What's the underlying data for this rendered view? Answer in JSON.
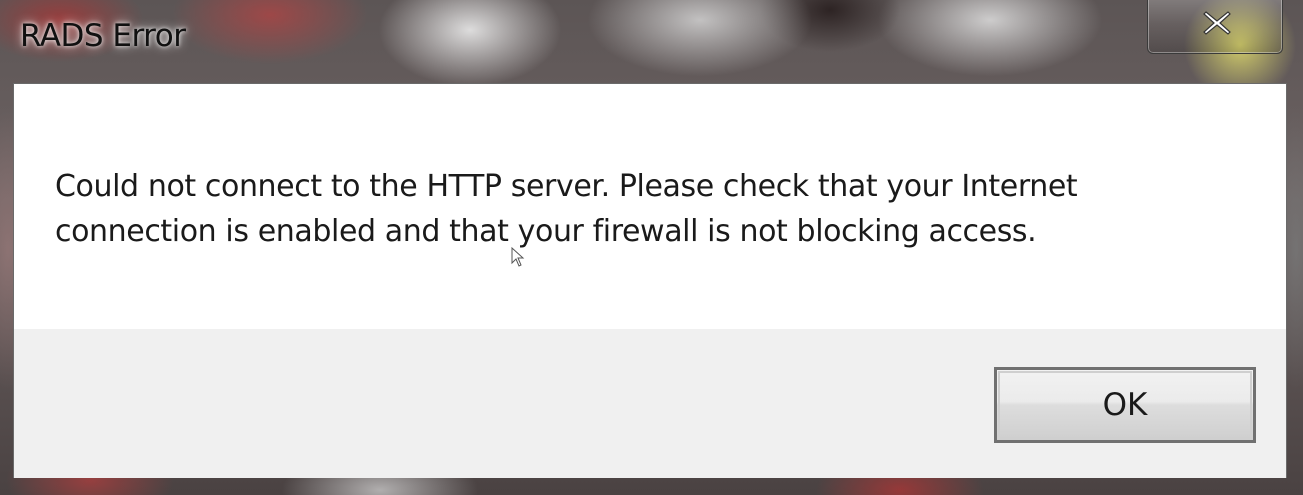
{
  "window": {
    "title": "RADS Error"
  },
  "dialog": {
    "message_line1": "Could not connect to the HTTP server.  Please check that your Internet",
    "message_line2": "connection is enabled and that your firewall is not blocking access.",
    "ok_label": "OK"
  },
  "icons": {
    "close": "close-icon",
    "cursor": "mouse-pointer-icon"
  },
  "colors": {
    "client_bg": "#ffffff",
    "button_bar_bg": "#f0f0f0",
    "text": "#1a1a1a"
  }
}
